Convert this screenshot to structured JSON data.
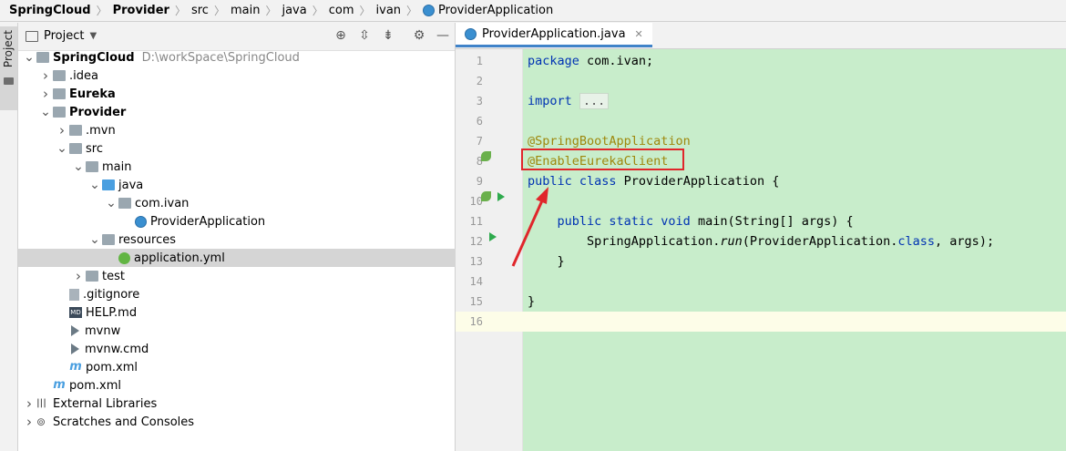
{
  "breadcrumb": {
    "items": [
      "SpringCloud",
      "Provider",
      "src",
      "main",
      "java",
      "com",
      "ivan",
      "ProviderApplication"
    ]
  },
  "left_strip": {
    "label": "Project"
  },
  "project_panel": {
    "title": "Project",
    "dropdown_icon": "chevron-down-icon",
    "toolbar_icons": [
      "locate-icon",
      "expand-all-icon",
      "collapse-all-icon",
      "gear-icon",
      "minimize-icon"
    ]
  },
  "tree": [
    {
      "label": "SpringCloud",
      "path": "D:\\workSpace\\SpringCloud",
      "bold": true,
      "depth": 0,
      "expand": "open",
      "icon": "module-folder-icon"
    },
    {
      "label": ".idea",
      "depth": 1,
      "expand": "closed",
      "icon": "folder-icon"
    },
    {
      "label": "Eureka",
      "bold": true,
      "depth": 1,
      "expand": "closed",
      "icon": "module-folder-icon"
    },
    {
      "label": "Provider",
      "bold": true,
      "depth": 1,
      "expand": "open",
      "icon": "module-folder-icon"
    },
    {
      "label": ".mvn",
      "depth": 2,
      "expand": "closed",
      "icon": "folder-icon"
    },
    {
      "label": "src",
      "depth": 2,
      "expand": "open",
      "icon": "folder-icon"
    },
    {
      "label": "main",
      "depth": 3,
      "expand": "open",
      "icon": "folder-icon"
    },
    {
      "label": "java",
      "depth": 4,
      "expand": "open",
      "icon": "source-folder-icon"
    },
    {
      "label": "com.ivan",
      "depth": 5,
      "expand": "open",
      "icon": "package-icon"
    },
    {
      "label": "ProviderApplication",
      "depth": 6,
      "expand": "none",
      "icon": "spring-class-icon"
    },
    {
      "label": "resources",
      "depth": 4,
      "expand": "open",
      "icon": "resources-folder-icon"
    },
    {
      "label": "application.yml",
      "depth": 5,
      "expand": "none",
      "icon": "yaml-file-icon",
      "selected": true
    },
    {
      "label": "test",
      "depth": 3,
      "expand": "closed",
      "icon": "folder-icon"
    },
    {
      "label": ".gitignore",
      "depth": 2,
      "expand": "none",
      "icon": "gitignore-file-icon"
    },
    {
      "label": "HELP.md",
      "depth": 2,
      "expand": "none",
      "icon": "markdown-file-icon"
    },
    {
      "label": "mvnw",
      "depth": 2,
      "expand": "none",
      "icon": "shell-file-icon"
    },
    {
      "label": "mvnw.cmd",
      "depth": 2,
      "expand": "none",
      "icon": "cmd-file-icon"
    },
    {
      "label": "pom.xml",
      "depth": 2,
      "expand": "none",
      "icon": "maven-file-icon"
    },
    {
      "label": "pom.xml",
      "depth": 1,
      "expand": "none",
      "icon": "maven-file-icon"
    },
    {
      "label": "External Libraries",
      "depth": 0,
      "expand": "closed",
      "icon": "libraries-icon"
    },
    {
      "label": "Scratches and Consoles",
      "depth": 0,
      "expand": "closed",
      "icon": "scratches-icon"
    }
  ],
  "editor": {
    "tab": {
      "label": "ProviderApplication.java",
      "close_icon": "close-icon"
    },
    "current_line": 16,
    "lines": [
      {
        "n": "1",
        "html": "<span class='kw'>package</span> com.ivan;"
      },
      {
        "n": "2",
        "html": ""
      },
      {
        "n": "3",
        "html": "<span class='kw'>import</span> <span class='fold-mini'>...</span>"
      },
      {
        "n": "6",
        "html": ""
      },
      {
        "n": "7",
        "html": "<span class='ann'>@SpringBootApplication</span>"
      },
      {
        "n": "8",
        "html": "<span class='ann'>@EnableEurekaClient</span>"
      },
      {
        "n": "9",
        "html": "<span class='kw'>public class</span> ProviderApplication {"
      },
      {
        "n": "10",
        "html": ""
      },
      {
        "n": "11",
        "html": "    <span class='kw'>public static void</span> main(String[] args) {"
      },
      {
        "n": "12",
        "html": "        SpringApplication.<span class='it'>run</span>(ProviderApplication.<span class='kw'>class</span>, args);"
      },
      {
        "n": "13",
        "html": "    }"
      },
      {
        "n": "14",
        "html": ""
      },
      {
        "n": "15",
        "html": "}"
      },
      {
        "n": "16",
        "html": ""
      }
    ]
  },
  "annotation": {
    "highlight_color": "#e0262b",
    "arrow_color": "#e0262b"
  }
}
